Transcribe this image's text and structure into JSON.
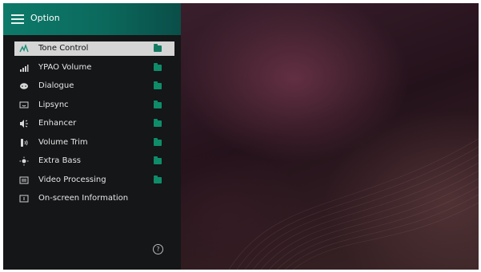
{
  "header": {
    "title": "Option"
  },
  "menu": {
    "items": [
      {
        "label": "Tone Control",
        "icon": "tone-control-icon",
        "selected": true,
        "has_folder": true
      },
      {
        "label": "YPAO Volume",
        "icon": "ypao-volume-icon",
        "has_folder": true
      },
      {
        "label": "Dialogue",
        "icon": "dialogue-icon",
        "has_folder": true
      },
      {
        "label": "Lipsync",
        "icon": "lipsync-icon",
        "has_folder": true
      },
      {
        "label": "Enhancer",
        "icon": "enhancer-icon",
        "has_folder": true
      },
      {
        "label": "Volume Trim",
        "icon": "volume-trim-icon",
        "has_folder": true
      },
      {
        "label": "Extra Bass",
        "icon": "extra-bass-icon",
        "has_folder": true
      },
      {
        "label": "Video Processing",
        "icon": "video-processing-icon",
        "has_folder": true
      },
      {
        "label": "On-screen Information",
        "icon": "on-screen-information-icon",
        "has_folder": false
      }
    ]
  },
  "help": {
    "symbol": "?"
  },
  "colors": {
    "header_start": "#0d7a6a",
    "header_end": "#0a4e48",
    "panel": "#141617",
    "highlight": "#d5d5d5",
    "folder": "#0f8c6a"
  }
}
